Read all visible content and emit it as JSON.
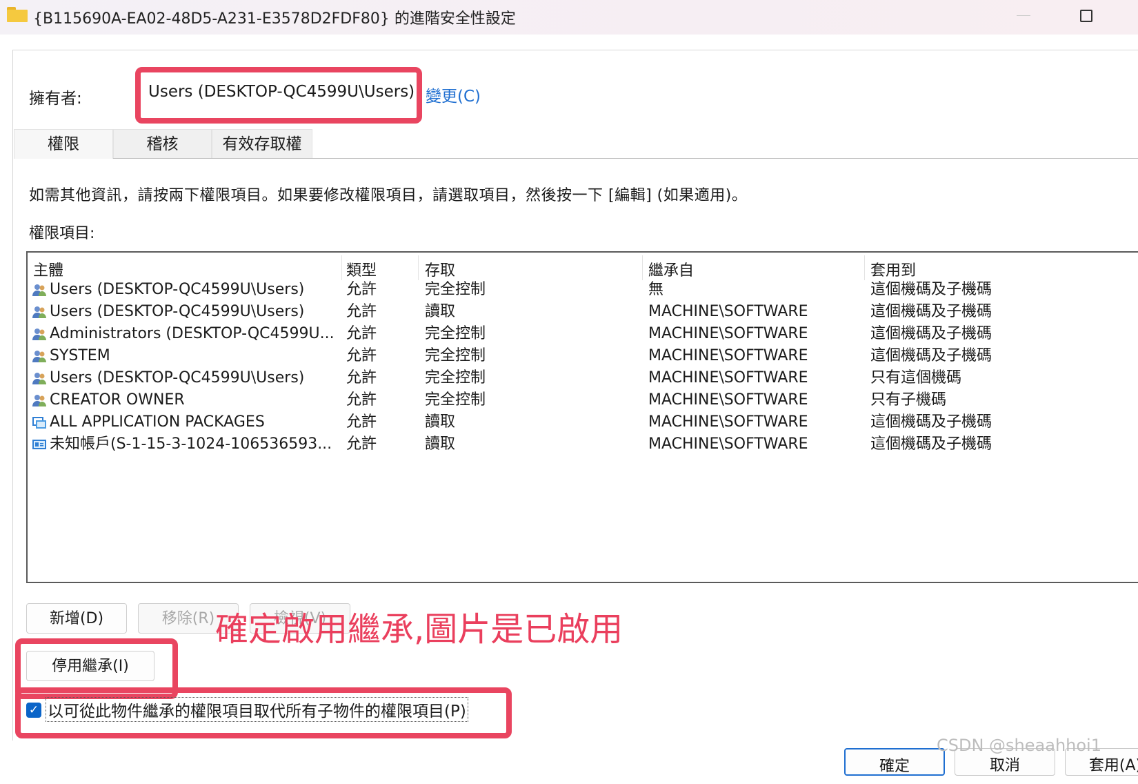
{
  "window": {
    "title": "{B115690A-EA02-48D5-A231-E3578D2FDF80} 的進階安全性設定"
  },
  "owner": {
    "label": "擁有者:",
    "value": "Users (DESKTOP-QC4599U\\Users)",
    "change_link": "變更(C)"
  },
  "tabs": [
    {
      "label": "權限",
      "active": true
    },
    {
      "label": "稽核",
      "active": false
    },
    {
      "label": "有效存取權",
      "active": false
    }
  ],
  "info_text": "如需其他資訊，請按兩下權限項目。如果要修改權限項目，請選取項目，然後按一下 [編輯] (如果適用)。",
  "entries_label": "權限項目:",
  "table": {
    "columns": [
      "主體",
      "類型",
      "存取",
      "繼承自",
      "套用到"
    ],
    "rows": [
      {
        "icon": "user-group-icon",
        "principal": "Users (DESKTOP-QC4599U\\Users)",
        "type": "允許",
        "access": "完全控制",
        "inherited_from": "無",
        "applies_to": "這個機碼及子機碼"
      },
      {
        "icon": "user-group-icon",
        "principal": "Users (DESKTOP-QC4599U\\Users)",
        "type": "允許",
        "access": "讀取",
        "inherited_from": "MACHINE\\SOFTWARE",
        "applies_to": "這個機碼及子機碼"
      },
      {
        "icon": "user-group-icon",
        "principal": "Administrators (DESKTOP-QC4599U...",
        "type": "允許",
        "access": "完全控制",
        "inherited_from": "MACHINE\\SOFTWARE",
        "applies_to": "這個機碼及子機碼"
      },
      {
        "icon": "user-group-icon",
        "principal": "SYSTEM",
        "type": "允許",
        "access": "完全控制",
        "inherited_from": "MACHINE\\SOFTWARE",
        "applies_to": "這個機碼及子機碼"
      },
      {
        "icon": "user-group-icon",
        "principal": "Users (DESKTOP-QC4599U\\Users)",
        "type": "允許",
        "access": "完全控制",
        "inherited_from": "MACHINE\\SOFTWARE",
        "applies_to": "只有這個機碼"
      },
      {
        "icon": "user-group-icon",
        "principal": "CREATOR OWNER",
        "type": "允許",
        "access": "完全控制",
        "inherited_from": "MACHINE\\SOFTWARE",
        "applies_to": "只有子機碼"
      },
      {
        "icon": "app-packages-icon",
        "principal": "ALL APPLICATION PACKAGES",
        "type": "允許",
        "access": "讀取",
        "inherited_from": "MACHINE\\SOFTWARE",
        "applies_to": "這個機碼及子機碼"
      },
      {
        "icon": "unknown-account-icon",
        "principal": "未知帳戶(S-1-15-3-1024-106536593...",
        "type": "允許",
        "access": "讀取",
        "inherited_from": "MACHINE\\SOFTWARE",
        "applies_to": "這個機碼及子機碼"
      }
    ]
  },
  "buttons": {
    "add": "新增(D)",
    "remove": "移除(R)",
    "view": "檢視(V)",
    "disable_inheritance": "停用繼承(I)",
    "ok": "確定",
    "cancel": "取消",
    "apply": "套用(A)"
  },
  "annotation": "確定啟用繼承,圖片是已啟用",
  "replace_checkbox": {
    "label": "以可從此物件繼承的權限項目取代所有子物件的權限項目(P)",
    "checked": true
  },
  "watermark": "CSDN @sheaahhoi1",
  "colors": {
    "highlight": "#e94560",
    "link": "#1f6fd1",
    "annotation": "#ea3f5d",
    "checkbox": "#0a64c8"
  }
}
